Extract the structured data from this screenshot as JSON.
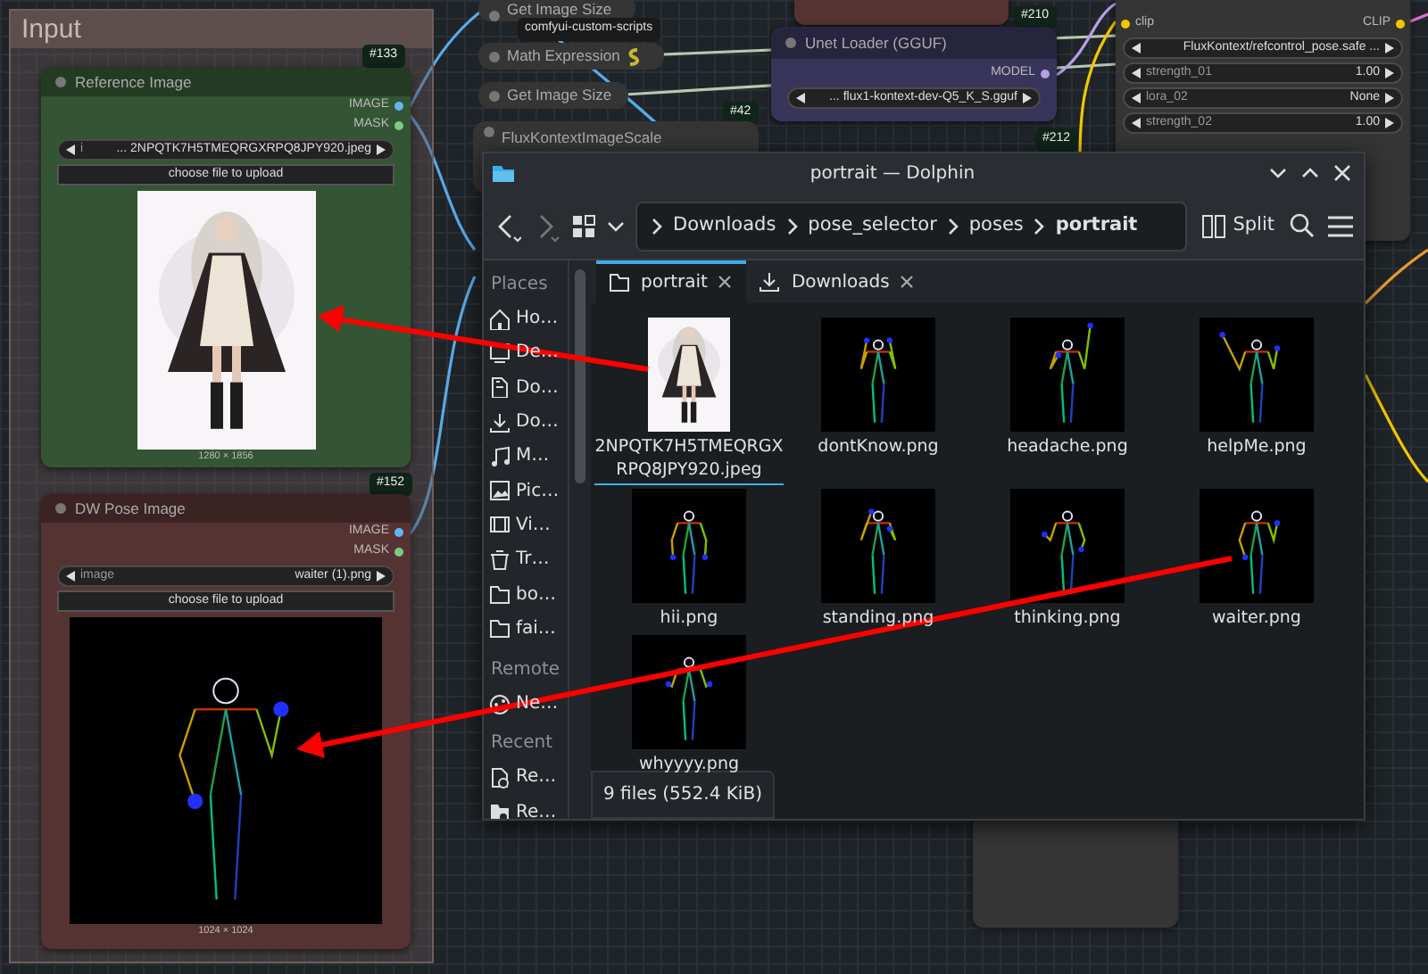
{
  "group": {
    "title": "Input"
  },
  "badges": [
    {
      "text": "#133"
    },
    {
      "text": "#152"
    },
    {
      "text": "#42"
    },
    {
      "text": "#210"
    },
    {
      "text": "#212"
    }
  ],
  "load_image_nodes": [
    {
      "title": "Reference Image",
      "color": "#335533",
      "outputs": [
        "IMAGE",
        "MASK"
      ],
      "combo_label": "i",
      "combo_value": "... 2NPQTK7H5TMEQRGXRPQ8JPY920.jpeg",
      "upload_button": "choose file to upload",
      "size": "1280 × 1856"
    },
    {
      "title": "DW Pose Image",
      "color": "#553333",
      "outputs": [
        "IMAGE",
        "MASK"
      ],
      "combo_label": "image",
      "combo_value": "waiter (1).png",
      "upload_button": "choose file to upload",
      "kind": "pose",
      "size": "1024 × 1024"
    }
  ],
  "utility_nodes": [
    {
      "title": "Get Image Size"
    },
    {
      "title": "Math Expression"
    },
    {
      "title": "Get Image Size"
    },
    {
      "title": "FluxKontextImageScale"
    }
  ],
  "tooltip": "comfyui-custom-scripts",
  "unet_node": {
    "title": "Unet Loader (GGUF)",
    "output": "MODEL",
    "combo_value": "... flux1-kontext-dev-Q5_K_S.gguf"
  },
  "lora_node": {
    "input": "clip",
    "output": "CLIP",
    "widgets": [
      {
        "value": "FluxKontext/refcontrol_pose.safe ..."
      },
      {
        "label": "strength_01",
        "value": "1.00"
      },
      {
        "label": "lora_02",
        "value": "None"
      },
      {
        "label": "strength_02",
        "value": "1.00"
      }
    ]
  },
  "file_manager": {
    "title": "portrait — Dolphin",
    "breadcrumb": [
      {
        "label": "Downloads",
        "current": false
      },
      {
        "label": "pose_selector",
        "current": false
      },
      {
        "label": "poses",
        "current": false
      },
      {
        "label": "portrait",
        "current": true
      }
    ],
    "split": "Split",
    "sidebar": [
      {
        "heading": "Places",
        "items": [
          {
            "label": "Ho…"
          },
          {
            "label": "De…"
          },
          {
            "label": "Do…"
          },
          {
            "label": "Do…"
          },
          {
            "label": "M…"
          },
          {
            "label": "Pic…"
          },
          {
            "label": "Vi…"
          },
          {
            "label": "Tr…"
          },
          {
            "label": "bo…"
          },
          {
            "label": "fai…"
          }
        ]
      },
      {
        "heading": "Remote",
        "items": [
          {
            "label": "Ne…"
          }
        ]
      },
      {
        "heading": "Recent",
        "items": [
          {
            "label": "Re…"
          },
          {
            "label": "Re…"
          }
        ]
      }
    ],
    "tabs": [
      {
        "label": "portrait",
        "selected": true
      },
      {
        "label": "Downloads",
        "selected": false
      }
    ],
    "files": [
      {
        "name": "2NPQTK7H5TMEQRGXRPQ8JPY920.jpeg",
        "selected": true
      },
      {
        "name": "dontKnow.png",
        "kind": "pose",
        "selected": false
      },
      {
        "name": "headache.png",
        "kind": "pose",
        "selected": false
      },
      {
        "name": "helpMe.png",
        "kind": "pose",
        "selected": false
      },
      {
        "name": "hii.png",
        "kind": "pose",
        "selected": false
      },
      {
        "name": "standing.png",
        "kind": "pose",
        "selected": false
      },
      {
        "name": "thinking.png",
        "kind": "pose",
        "selected": false
      },
      {
        "name": "waiter.png",
        "kind": "pose",
        "selected": false
      },
      {
        "name": "whyyyy.png",
        "kind": "pose",
        "selected": false
      }
    ],
    "status": "9 files (552.4 KiB)"
  }
}
